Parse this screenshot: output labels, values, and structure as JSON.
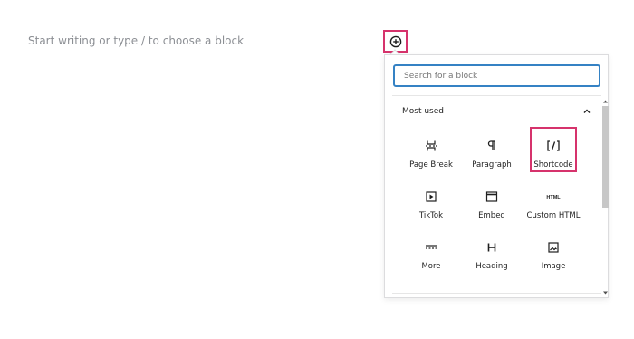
{
  "editor": {
    "placeholder": "Start writing or type / to choose a block"
  },
  "inserter": {
    "search_placeholder": "Search for a block",
    "section_title": "Most used",
    "blocks": [
      {
        "label": "Page Break",
        "icon": "page-break-icon"
      },
      {
        "label": "Paragraph",
        "icon": "paragraph-icon"
      },
      {
        "label": "Shortcode",
        "icon": "shortcode-icon"
      },
      {
        "label": "TikTok",
        "icon": "tiktok-embed-icon"
      },
      {
        "label": "Embed",
        "icon": "embed-icon"
      },
      {
        "label": "Custom HTML",
        "icon": "html-icon"
      },
      {
        "label": "More",
        "icon": "more-icon"
      },
      {
        "label": "Heading",
        "icon": "heading-icon"
      },
      {
        "label": "Image",
        "icon": "image-icon"
      }
    ]
  },
  "colors": {
    "highlight": "#d6336c",
    "focus_border": "#3582c4",
    "placeholder_text": "#8c8f94"
  }
}
